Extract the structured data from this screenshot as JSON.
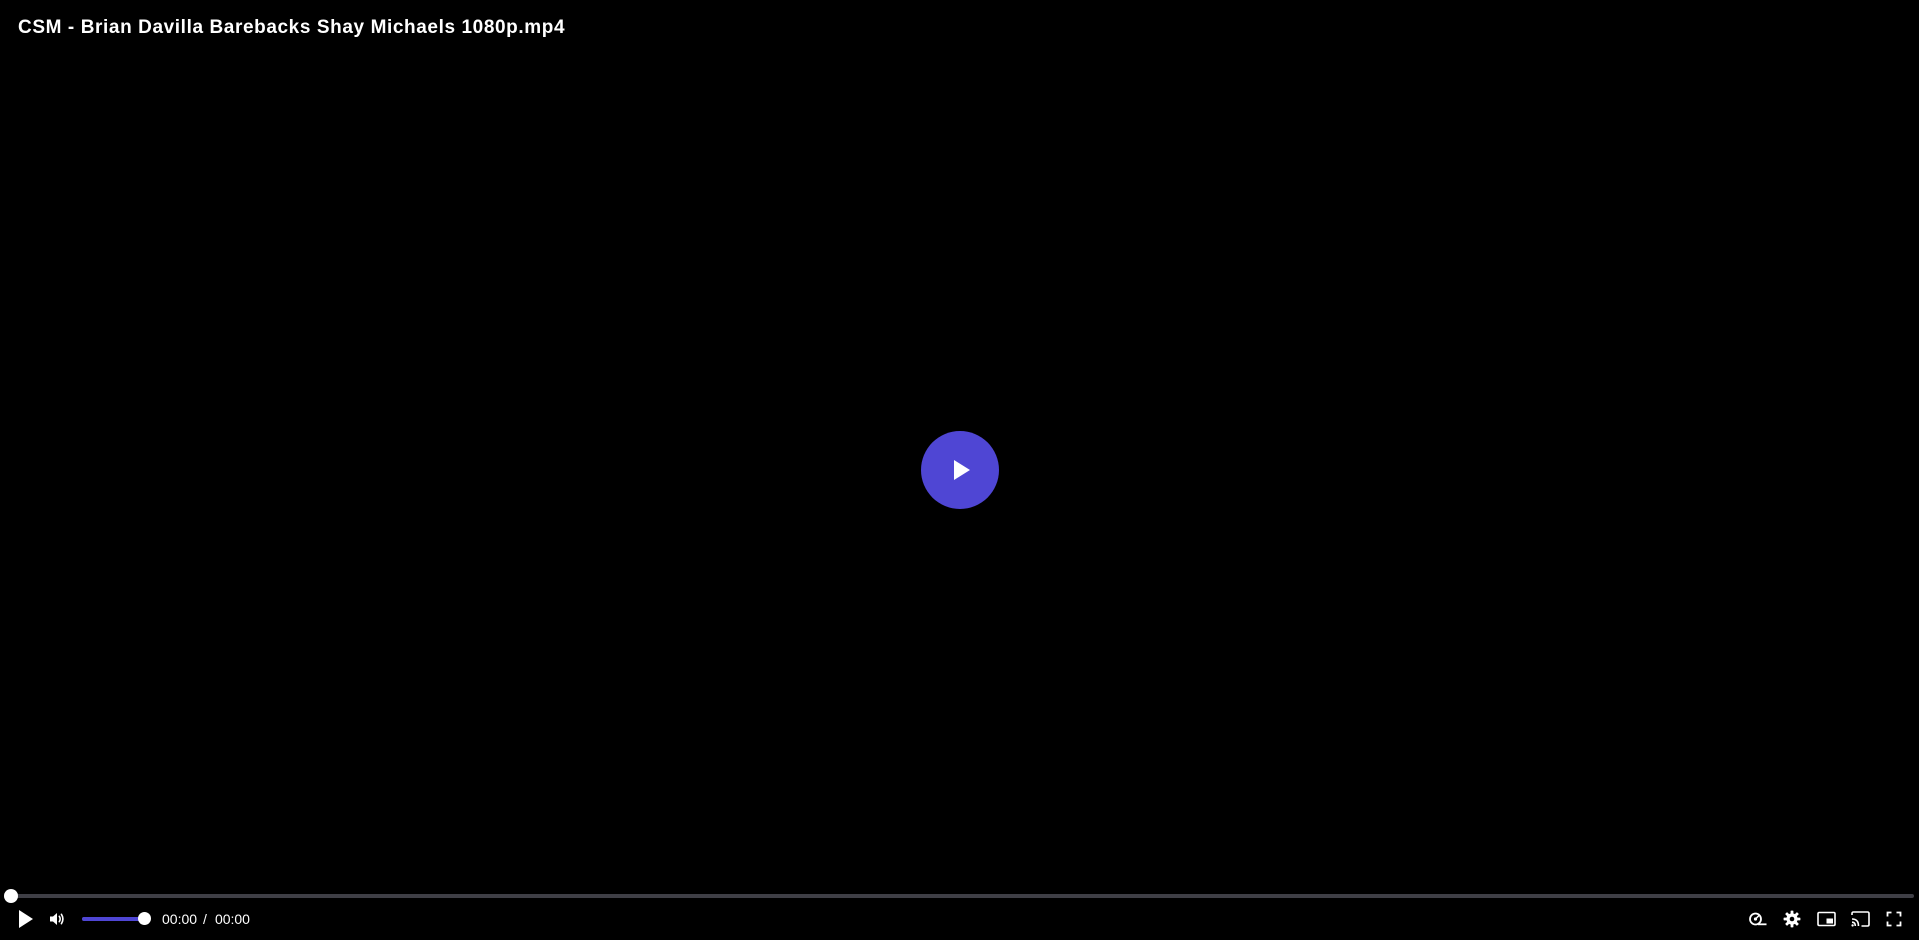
{
  "player": {
    "title": "CSM - Brian Davilla Barebacks Shay Michaels 1080p.mp4",
    "accent_color": "#4f46d4",
    "progress_fraction": 0,
    "volume_fraction": 1,
    "time": {
      "current": "00:00",
      "separator": "/",
      "duration": "00:00"
    },
    "icons": {
      "big_play": "play-icon",
      "play": "play-icon",
      "mute": "volume-high-icon",
      "speed": "playback-speed-icon",
      "settings": "gear-icon",
      "pip": "picture-in-picture-icon",
      "cast": "cast-icon",
      "fullscreen": "fullscreen-icon"
    }
  }
}
